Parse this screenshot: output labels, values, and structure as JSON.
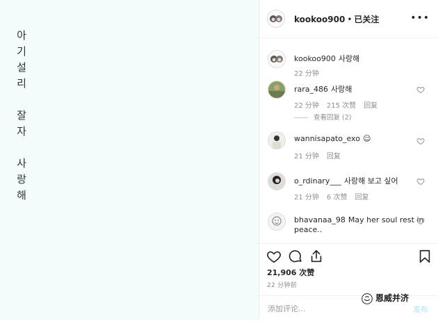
{
  "image_text": {
    "lines": [
      "아",
      "기",
      "설",
      "리",
      "",
      "잘",
      "자",
      "",
      "사",
      "랑",
      "해"
    ]
  },
  "header": {
    "username": "kookoo900",
    "dot": "•",
    "follow_status": "已关注",
    "more_label": "•••"
  },
  "comments": [
    {
      "user": "kookoo900",
      "text": "사랑해",
      "time": "22 分钟"
    },
    {
      "user": "rara_486",
      "text": "사랑해",
      "time": "22 分钟",
      "likes": "215 次赞",
      "reply": "回复",
      "view_replies": "查看回复 (2)"
    },
    {
      "user": "wannisapato_exo",
      "text": "☺",
      "time": "21 分钟",
      "reply": "回复"
    },
    {
      "user": "o_rdinary___",
      "text": "사랑해 보고 싶어",
      "time": "21 分钟",
      "likes": "6 次赞",
      "reply": "回复"
    },
    {
      "user": "bhavanaa_98",
      "text": "May her soul rest in",
      "text2": "peace.."
    }
  ],
  "actions": {
    "likes": "21,906 次赞",
    "time_ago": "22 分钟前"
  },
  "add_comment": {
    "placeholder": "添加评论...",
    "post_label": "发布"
  },
  "watermark": {
    "text": "恩威并济"
  },
  "colors": {
    "image_bg": "#f4fbfb",
    "border": "#efefef",
    "muted": "#8e8e8e",
    "post_btn": "#b2dffc"
  }
}
